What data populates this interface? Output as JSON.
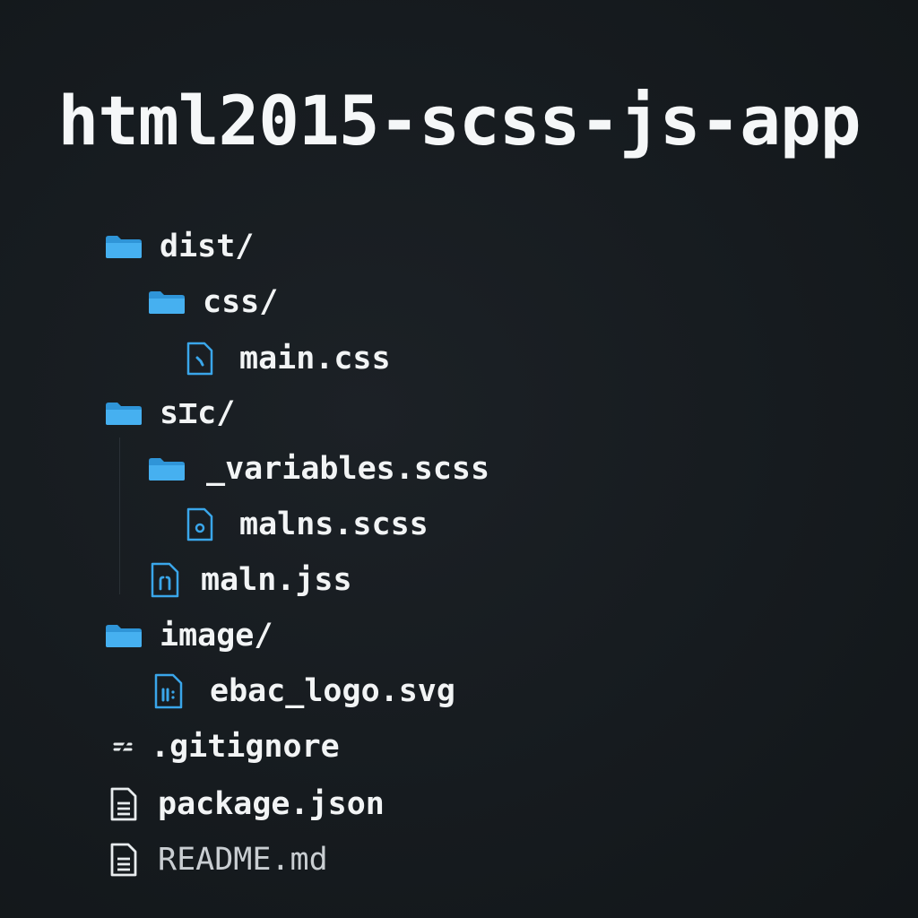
{
  "title": "html2015-scss-js-app",
  "tree": {
    "dist": {
      "icon": "folder-icon",
      "label": "dist/"
    },
    "dist_css": {
      "icon": "folder-icon",
      "label": "css/"
    },
    "main_css": {
      "icon": "file-code-icon",
      "label": "main.css"
    },
    "src": {
      "icon": "folder-icon",
      "label": "s⌶c/"
    },
    "variables": {
      "icon": "folder-icon",
      "label": "_variables.scss"
    },
    "malns": {
      "icon": "file-code-icon",
      "label": "malns.scss"
    },
    "maln_js": {
      "icon": "file-code-icon",
      "label": "maln.jss"
    },
    "image": {
      "icon": "folder-icon",
      "label": "image/"
    },
    "ebac_logo": {
      "icon": "file-image-icon",
      "label": "ebac_logo.svg"
    },
    "gitignore": {
      "icon": "config-icon",
      "label": ".gitignore"
    },
    "package_json": {
      "icon": "document-icon",
      "label": "package.json"
    },
    "readme": {
      "icon": "document-icon",
      "label": "README.md"
    }
  },
  "colors": {
    "background": "#161b1f",
    "folder": "#3aa6ea",
    "file_icon": "#3aa6ea",
    "text": "#f2f4f5"
  }
}
